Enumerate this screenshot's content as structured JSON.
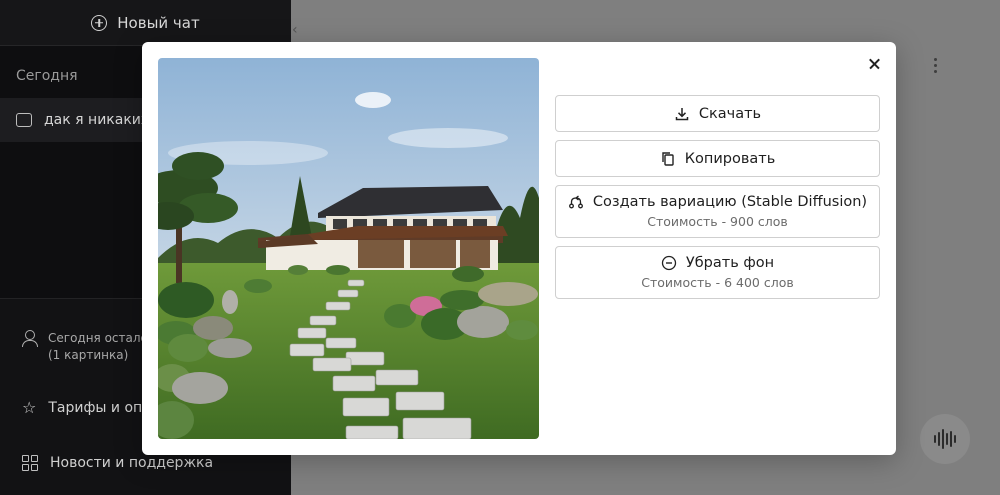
{
  "sidebar": {
    "new_chat_label": "Новый чат",
    "section_today": "Сегодня",
    "chat_item_label": "дак я никаких",
    "quota_line1": "Сегодня остало",
    "quota_line2": "(1 картинка)",
    "tariffs_label": "Тарифы и опл",
    "news_label": "Новости и поддержка"
  },
  "main": {
    "top_text": "..."
  },
  "modal": {
    "download_label": "Скачать",
    "copy_label": "Копировать",
    "variation_label": "Создать вариацию (Stable Diffusion)",
    "variation_cost": "Стоимость - 900 слов",
    "remove_bg_label": "Убрать фон",
    "remove_bg_cost": "Стоимость - 6 400 слов"
  },
  "icons": {
    "new_chat": "plus-circle-icon",
    "chat": "message-icon",
    "user": "user-icon",
    "tariffs": "star-icon",
    "news": "grid-icon",
    "download": "download-icon",
    "copy": "copy-icon",
    "variation": "variation-icon",
    "remove_bg": "minus-circle-icon",
    "close": "close-icon",
    "voice": "voice-wave-icon"
  },
  "colors": {
    "sidebar_bg": "#0e0e10",
    "overlay_bg": "#7f7f7f",
    "modal_bg": "#ffffff",
    "button_border": "#cfcfcf"
  }
}
